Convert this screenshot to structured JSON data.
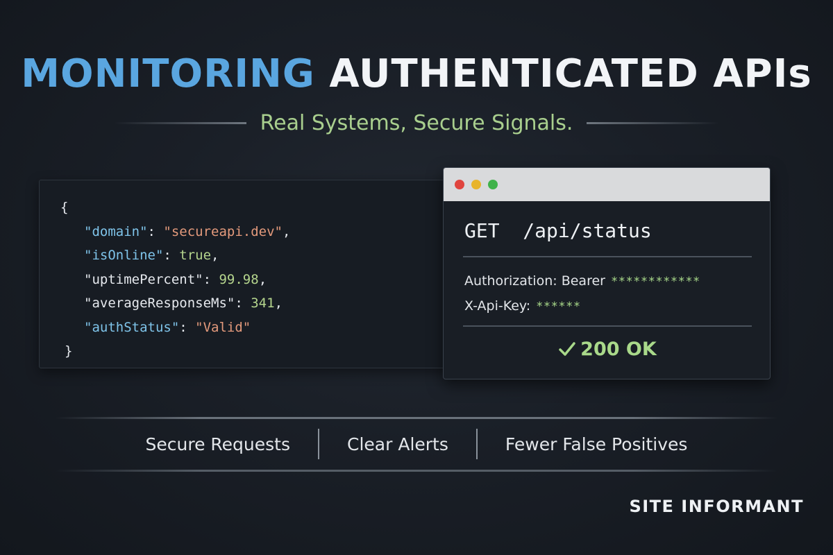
{
  "title": {
    "accent": "MONITORING",
    "main": "AUTHENTICATED APIs"
  },
  "subtitle": "Real Systems, Secure Signals.",
  "json_panel": {
    "open_brace": "{",
    "close_brace": "}",
    "lines": [
      {
        "key": "\"domain\"",
        "sep": ": ",
        "value": "\"secureapi.dev\"",
        "trail": ","
      },
      {
        "key": "\"isOnline\"",
        "sep": ": ",
        "value": "true",
        "trail": ","
      },
      {
        "key": "\"uptimePercent\"",
        "sep": ": ",
        "value": "99.98",
        "trail": ","
      },
      {
        "key": "\"averageResponseMs\"",
        "sep": ": ",
        "value": "341",
        "trail": ","
      },
      {
        "key": "\"authStatus\"",
        "sep": ": ",
        "value": "\"Valid\"",
        "trail": ""
      }
    ]
  },
  "request_panel": {
    "method": "GET",
    "path": "/api/status",
    "headers": [
      {
        "name": "Authorization: Bearer",
        "value": "************"
      },
      {
        "name": "X-Api-Key:",
        "value": "******"
      }
    ],
    "status": "200 OK",
    "status_icon": "check-icon"
  },
  "features": [
    "Secure Requests",
    "Clear Alerts",
    "Fewer False Positives"
  ],
  "brand": "SITE INFORMANT",
  "colors": {
    "accent_blue": "#5aa6e0",
    "success_green": "#a9d98a",
    "string_orange": "#e49a7c",
    "key_blue": "#7fc4ea"
  }
}
